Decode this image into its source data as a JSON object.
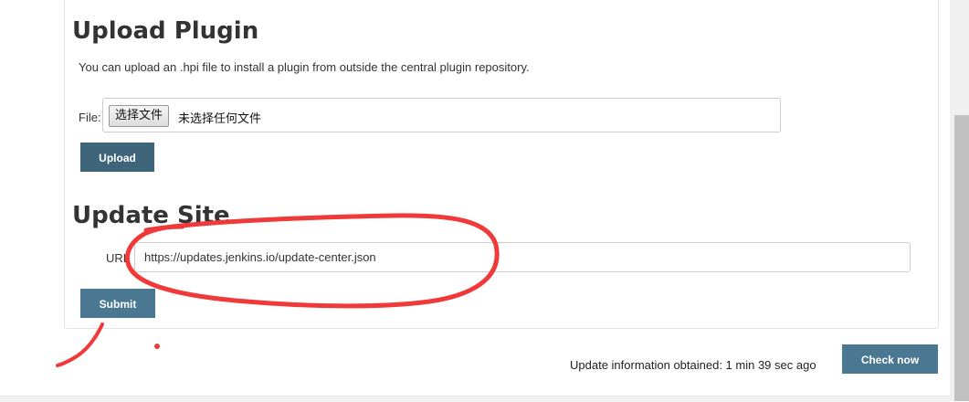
{
  "upload": {
    "heading": "Upload Plugin",
    "description": "You can upload an .hpi file to install a plugin from outside the central plugin repository.",
    "file_label": "File:",
    "choose_file_label": "选择文件",
    "no_file_text": "未选择任何文件",
    "upload_button": "Upload"
  },
  "update_site": {
    "heading": "Update Site",
    "url_label": "URL",
    "url_value": "https://updates.jenkins.io/update-center.json",
    "submit_button": "Submit"
  },
  "footer": {
    "status_text": "Update information obtained: 1 min 39 sec ago",
    "check_now_button": "Check now"
  },
  "colors": {
    "button_primary": "#3e6579",
    "button_secondary": "#4a7892",
    "annotation": "#f03a3a"
  }
}
